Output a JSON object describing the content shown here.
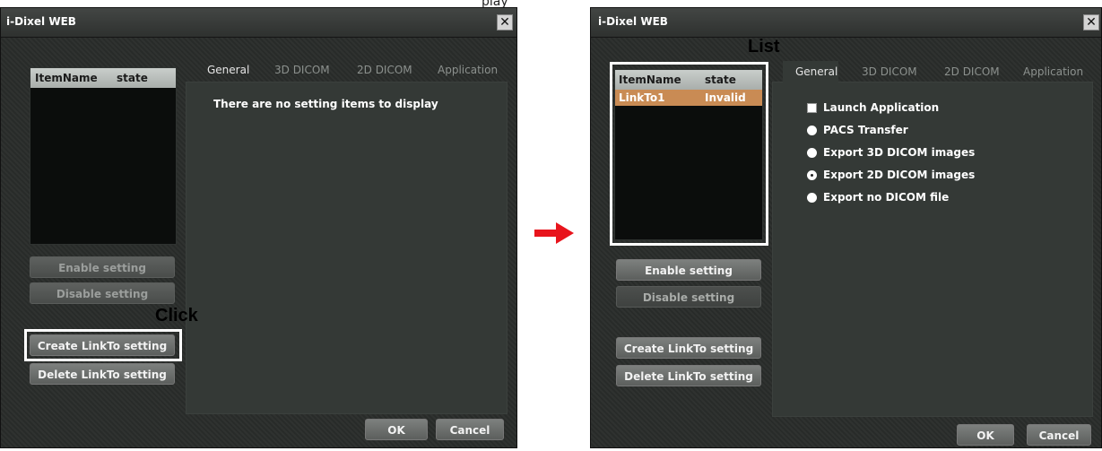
{
  "clipped_text": "play",
  "annotations": {
    "click": "Click",
    "list": "List"
  },
  "window_before": {
    "title": "i-Dixel WEB",
    "close_glyph": "✕",
    "list": {
      "col_itemname": "ItemName",
      "col_state": "state"
    },
    "tabs": [
      "General",
      "3D DICOM",
      "2D DICOM",
      "Application"
    ],
    "message": "There are no setting items to display",
    "buttons": {
      "enable": "Enable setting",
      "disable": "Disable setting",
      "create": "Create LinkTo setting",
      "delete": "Delete LinkTo setting",
      "ok": "OK",
      "cancel": "Cancel"
    }
  },
  "window_after": {
    "title": "i-Dixel WEB",
    "close_glyph": "✕",
    "list": {
      "col_itemname": "ItemName",
      "col_state": "state",
      "rows": [
        {
          "item": "LinkTo1",
          "state": "Invalid"
        }
      ]
    },
    "tabs": [
      "General",
      "3D DICOM",
      "2D DICOM",
      "Application"
    ],
    "options": [
      {
        "label": "Launch Application",
        "kind": "checkbox",
        "checked": false
      },
      {
        "label": "PACS Transfer",
        "kind": "radio",
        "checked": false
      },
      {
        "label": "Export 3D DICOM images",
        "kind": "radio",
        "checked": false
      },
      {
        "label": "Export 2D DICOM images",
        "kind": "radio",
        "checked": true
      },
      {
        "label": "Export no DICOM file",
        "kind": "radio",
        "checked": false
      }
    ],
    "buttons": {
      "enable": "Enable setting",
      "disable": "Disable setting",
      "create": "Create LinkTo setting",
      "delete": "Delete LinkTo setting",
      "ok": "OK",
      "cancel": "Cancel"
    }
  },
  "colors": {
    "arrow": "#e8141c",
    "selected_row": "#c98b54"
  },
  "icons": {
    "arrow": "arrow-right-icon",
    "close": "close-icon"
  }
}
